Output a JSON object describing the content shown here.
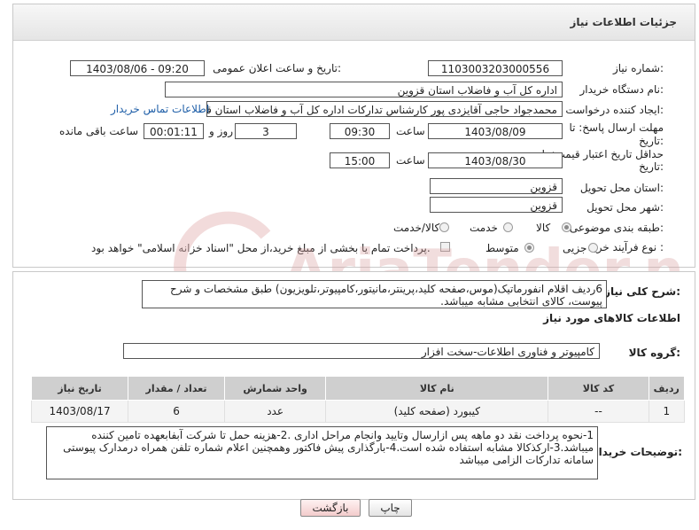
{
  "header": {
    "title": "جزئیات اطلاعات نیاز"
  },
  "fields": {
    "need_number_label": "شماره نیاز:",
    "need_number": "1103003203000556",
    "announce_label": "تاریخ و ساعت اعلان عمومی:",
    "announce_value": "1403/08/06 - 09:20",
    "buyer_org_label": "نام دستگاه خریدار:",
    "buyer_org": "اداره کل آب و فاضلاب استان قزوین",
    "requester_label": "ایجاد کننده درخواست:",
    "requester": "محمدجواد حاجی آقایزدی پور کارشناس تدارکات اداره کل آب و فاضلاب استان قزو",
    "contact_link": "اطلاعات تماس خریدار",
    "deadline_label_1": "مهلت ارسال پاسخ: تا",
    "deadline_label_2": "تاریخ:",
    "deadline_date": "1403/08/09",
    "time_label": "ساعت",
    "deadline_time": "09:30",
    "days_value": "3",
    "days_label": "روز و",
    "remaining_time": "00:01:11",
    "remaining_label": "ساعت باقی مانده",
    "validity_label_1": "حداقل تاریخ اعتبار قیمت: تا",
    "validity_label_2": "تاریخ:",
    "validity_date": "1403/08/30",
    "validity_time_label": "ساعت",
    "validity_time": "15:00",
    "province_label": "استان محل تحویل:",
    "province": "قزوین",
    "city_label": "شهر محل تحویل:",
    "city": "قزوین",
    "category_label": "طبقه بندی موضوعی:",
    "category_options": [
      "کالا",
      "خدمت",
      "کالا/خدمت"
    ],
    "category_selected": "کالا",
    "process_label": "نوع فرآیند خرید :",
    "process_options": [
      "جزیی",
      "متوسط"
    ],
    "process_selected": "متوسط",
    "payment_note": "پرداخت تمام یا بخشی از مبلغ خرید،از محل \"اسناد خزانه اسلامی\" خواهد بود."
  },
  "details": {
    "summary_label": "شرح کلی نیاز:",
    "summary_text": "6ردیف اقلام انفورماتیک(موس،صفحه کلید،پرینتر،مانیتور،کامپیوتر،تلویزیون) طبق مشخصات و شرح پیوست، کالای انتخابی مشابه میباشد.",
    "goods_info_title": "اطلاعات کالاهای مورد نیاز",
    "goods_group_label": "گروه کالا:",
    "goods_group": "کامپیوتر و فناوری اطلاعات-سخت افزار",
    "table": {
      "headers": [
        "ردیف",
        "کد کالا",
        "نام کالا",
        "واحد شمارش",
        "تعداد / مقدار",
        "تاریخ نیاز"
      ],
      "rows": [
        [
          "1",
          "--",
          "کیبورد (صفحه کلید)",
          "عدد",
          "6",
          "1403/08/17"
        ]
      ]
    },
    "buyer_notes_label": "توضیحات خریدار:",
    "buyer_notes": "1-نحوه پرداخت نقد دو ماهه پس ازارسال وتایید وانجام مراحل اداری .2-هزینه حمل تا شرکت آبفابعهده تامین کننده میباشد.3-ارکذکالا مشابه استفاده شده است.4-بارگذاری پیش فاکتور وهمچنین اعلام شماره تلفن همراه درمدارک پیوستی سامانه تدارکات الزامی میباشد"
  },
  "buttons": {
    "print": "چاپ",
    "back": "بازگشت"
  },
  "watermark": {
    "text": "AriaTender.neT",
    "color": "#d9a0a0"
  }
}
